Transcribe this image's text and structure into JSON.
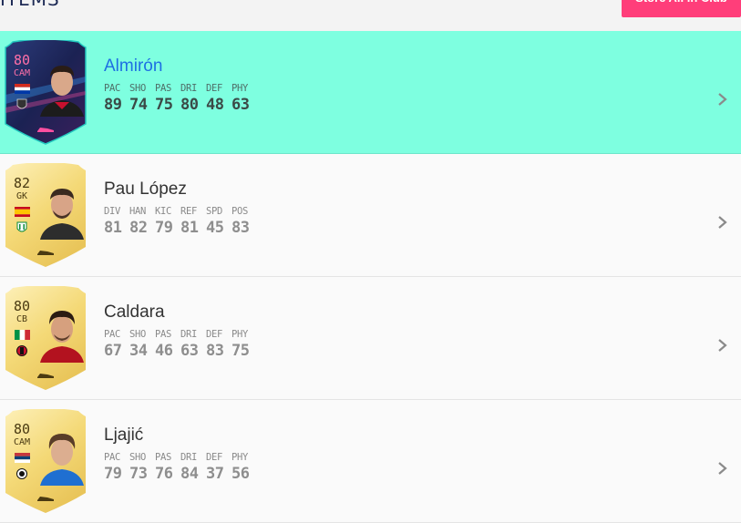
{
  "header": {
    "section_title": "ITEMS",
    "store_button_label": "Store All in Club"
  },
  "players": [
    {
      "name": "Almirón",
      "rating": "80",
      "position": "CAM",
      "card_style": "special",
      "nation_flag": "paraguay-flag",
      "stat_labels": [
        "PAC",
        "SHO",
        "PAS",
        "DRI",
        "DEF",
        "PHY"
      ],
      "stat_values": [
        "89",
        "74",
        "75",
        "80",
        "48",
        "63"
      ],
      "selected": true
    },
    {
      "name": "Pau López",
      "rating": "82",
      "position": "GK",
      "card_style": "gold",
      "nation_flag": "spain-flag",
      "stat_labels": [
        "DIV",
        "HAN",
        "KIC",
        "REF",
        "SPD",
        "POS"
      ],
      "stat_values": [
        "81",
        "82",
        "79",
        "81",
        "45",
        "83"
      ],
      "selected": false
    },
    {
      "name": "Caldara",
      "rating": "80",
      "position": "CB",
      "card_style": "gold",
      "nation_flag": "italy-flag",
      "stat_labels": [
        "PAC",
        "SHO",
        "PAS",
        "DRI",
        "DEF",
        "PHY"
      ],
      "stat_values": [
        "67",
        "34",
        "46",
        "63",
        "83",
        "75"
      ],
      "selected": false
    },
    {
      "name": "Ljajić",
      "rating": "80",
      "position": "CAM",
      "card_style": "gold",
      "nation_flag": "serbia-flag",
      "stat_labels": [
        "PAC",
        "SHO",
        "PAS",
        "DRI",
        "DEF",
        "PHY"
      ],
      "stat_values": [
        "79",
        "73",
        "76",
        "84",
        "37",
        "56"
      ],
      "selected": false
    }
  ],
  "colors": {
    "selected_row": "#7effe0",
    "selected_name": "#1e6fe3",
    "store_button": "#ff3e7a",
    "gold_card": "#f6dc86",
    "special_card": "#1e2757"
  }
}
